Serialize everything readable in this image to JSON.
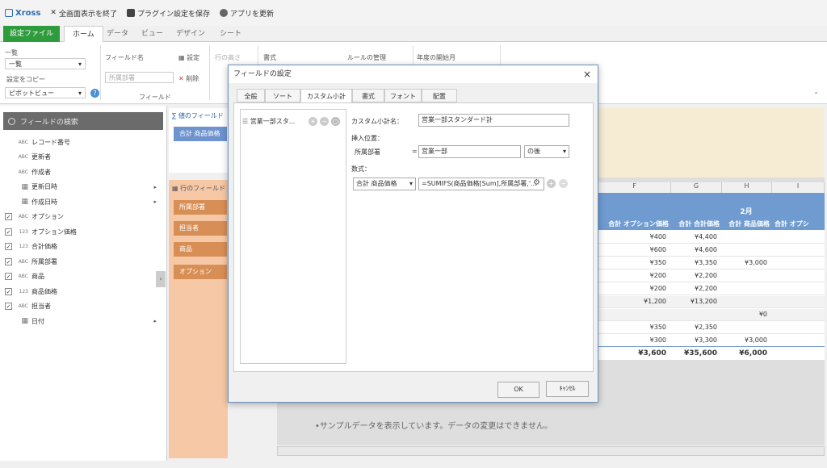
{
  "topbar": {
    "brand": "Xross",
    "exit_fullscreen": "全画面表示を終了",
    "save_plugin": "プラグイン設定を保存",
    "update_app": "アプリを更新"
  },
  "tabs": {
    "file": "設定ファイル",
    "home": "ホーム",
    "data": "データ",
    "view": "ビュー",
    "design": "デザイン",
    "sheet": "シート"
  },
  "ribbon": {
    "list_label": "一覧",
    "list_value": "一覧",
    "copy_settings": "設定をコピー",
    "pivot_view": "ピボットビュー",
    "field_name_label": "フィールド名",
    "field_name_placeholder": "所属部署",
    "field_group": "フィールド",
    "settings_btn": "設定",
    "delete_btn": "削除",
    "row_height": "行の高さ",
    "format_btn": "書式",
    "rule_manage": "ルールの管理",
    "fiscal_start": "年度の開始月"
  },
  "left": {
    "search_placeholder": "フィールドの検索",
    "fields": [
      {
        "type": "ABC",
        "label": "レコード番号",
        "checked": false,
        "icon": "type-text-icon"
      },
      {
        "type": "ABC",
        "label": "更新者",
        "checked": false,
        "icon": "type-text-icon"
      },
      {
        "type": "ABC",
        "label": "作成者",
        "checked": false,
        "icon": "type-text-icon"
      },
      {
        "type": "",
        "label": "更新日時",
        "checked": false,
        "icon": "calendar-icon",
        "arrow": "▸"
      },
      {
        "type": "",
        "label": "作成日時",
        "checked": false,
        "icon": "calendar-icon",
        "arrow": "▸"
      },
      {
        "type": "ABC",
        "label": "オプション",
        "checked": true,
        "icon": "type-text-icon"
      },
      {
        "type": "123",
        "label": "オプション価格",
        "checked": true,
        "icon": "type-number-icon"
      },
      {
        "type": "123",
        "label": "合計価格",
        "checked": true,
        "icon": "type-number-icon"
      },
      {
        "type": "ABC",
        "label": "所属部署",
        "checked": true,
        "icon": "type-text-icon"
      },
      {
        "type": "ABC",
        "label": "商品",
        "checked": true,
        "icon": "type-text-icon"
      },
      {
        "type": "123",
        "label": "商品価格",
        "checked": true,
        "icon": "type-number-icon"
      },
      {
        "type": "ABC",
        "label": "担当者",
        "checked": true,
        "icon": "type-text-icon"
      },
      {
        "type": "",
        "label": "日付",
        "checked": false,
        "icon": "calendar-icon",
        "arrow": "▸"
      }
    ]
  },
  "zones": {
    "values_title": "値のフィールド",
    "value_chip": "合計 商品価格",
    "rows_title": "行のフィールド",
    "row_chips": [
      "所属部署",
      "担当者",
      "商品",
      "オプション"
    ]
  },
  "pivot": {
    "cols": [
      "F",
      "G",
      "H",
      "I"
    ],
    "month": "2月",
    "headers": [
      "合計 オプション価格",
      "合計 合計価格",
      "合計 商品価格",
      "合計 オプシ"
    ],
    "rows": [
      [
        "¥400",
        "¥4,400",
        "",
        ""
      ],
      [
        "¥600",
        "¥4,600",
        "",
        ""
      ],
      [
        "¥350",
        "¥3,350",
        "¥3,000",
        ""
      ],
      [
        "¥200",
        "¥2,200",
        "",
        ""
      ],
      [
        "¥200",
        "¥2,200",
        "",
        ""
      ],
      [
        "¥1,200",
        "¥13,200",
        "",
        ""
      ],
      [
        "",
        "",
        "¥0",
        ""
      ],
      [
        "¥350",
        "¥2,350",
        "",
        ""
      ],
      [
        "¥300",
        "¥3,300",
        "¥3,000",
        ""
      ],
      [
        "¥3,600",
        "¥35,600",
        "¥6,000",
        ""
      ]
    ],
    "sample_note": "•サンプルデータを表示しています。データの変更はできません。"
  },
  "dialog": {
    "title": "フィールドの設定",
    "close": "×",
    "tabs": [
      "全般",
      "ソート",
      "カスタム小計",
      "書式",
      "フォント",
      "配置"
    ],
    "active_tab": 2,
    "list_item": "営業一部スタ...",
    "subtotal_name_label": "カスタム小計名：",
    "subtotal_name_value": "営業一部スタンダード計",
    "insert_pos_label": "挿入位置：",
    "insert_field": "所属部署",
    "equals": "=",
    "insert_value": "営業一部",
    "after": "の後",
    "formula_label": "数式：",
    "formula_field": "合計 商品価格",
    "formula_value": "=SUMIFS(商品価格[Sum],所属部署,'...",
    "ok": "OK",
    "cancel": "ｷｬﾝｾﾙ"
  },
  "colors": {
    "file_tab": "#2e9b3d",
    "pivot_header": "#6f9bd1",
    "row_chip": "#d88f55",
    "dialog_border": "#6a8fbf"
  }
}
